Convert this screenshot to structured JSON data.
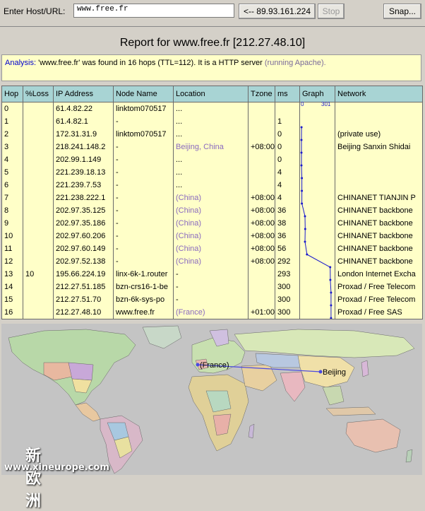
{
  "toolbar": {
    "label": "Enter Host/URL:",
    "host_value": "www.free.fr",
    "ip_button": "<-- 89.93.161.224",
    "stop_button": "Stop",
    "snap_button": "Snap..."
  },
  "report": {
    "title": "Report for www.free.fr [212.27.48.10]"
  },
  "analysis": {
    "label": "Analysis:",
    "text": " 'www.free.fr'  was found in 16 hops (TTL=112). It is a HTTP server ",
    "server_note": "(running Apache)."
  },
  "table": {
    "headers": [
      "Hop",
      "%Loss",
      "IP Address",
      "Node Name",
      "Location",
      "Tzone",
      "ms",
      "Graph",
      "Network"
    ],
    "graph_scale": {
      "min": "0",
      "max": "301"
    },
    "rows": [
      {
        "hop": "0",
        "loss": "",
        "ip": "61.4.82.22",
        "node": "linktom070517",
        "loc": "...",
        "tz": "",
        "ms": "",
        "net": ""
      },
      {
        "hop": "1",
        "loss": "",
        "ip": "61.4.82.1",
        "node": "-",
        "loc": "...",
        "tz": "",
        "ms": "1",
        "net": ""
      },
      {
        "hop": "2",
        "loss": "",
        "ip": "172.31.31.9",
        "node": "linktom070517",
        "loc": "...",
        "tz": "",
        "ms": "0",
        "net": "(private use)"
      },
      {
        "hop": "3",
        "loss": "",
        "ip": "218.241.148.2",
        "node": "-",
        "loc": "Beijing, China",
        "tz": "+08:00",
        "ms": "0",
        "net": "Beijing Sanxin Shidai"
      },
      {
        "hop": "4",
        "loss": "",
        "ip": "202.99.1.149",
        "node": "-",
        "loc": "...",
        "tz": "",
        "ms": "0",
        "net": ""
      },
      {
        "hop": "5",
        "loss": "",
        "ip": "221.239.18.13",
        "node": "-",
        "loc": "...",
        "tz": "",
        "ms": "4",
        "net": ""
      },
      {
        "hop": "6",
        "loss": "",
        "ip": "221.239.7.53",
        "node": "-",
        "loc": "...",
        "tz": "",
        "ms": "4",
        "net": ""
      },
      {
        "hop": "7",
        "loss": "",
        "ip": "221.238.222.1",
        "node": "-",
        "loc": "(China)",
        "tz": "+08:00",
        "ms": "4",
        "net": "CHINANET TIANJIN P"
      },
      {
        "hop": "8",
        "loss": "",
        "ip": "202.97.35.125",
        "node": "-",
        "loc": "(China)",
        "tz": "+08:00",
        "ms": "36",
        "net": "CHINANET backbone"
      },
      {
        "hop": "9",
        "loss": "",
        "ip": "202.97.35.186",
        "node": "-",
        "loc": "(China)",
        "tz": "+08:00",
        "ms": "38",
        "net": "CHINANET backbone"
      },
      {
        "hop": "10",
        "loss": "",
        "ip": "202.97.60.206",
        "node": "-",
        "loc": "(China)",
        "tz": "+08:00",
        "ms": "36",
        "net": "CHINANET backbone"
      },
      {
        "hop": "11",
        "loss": "",
        "ip": "202.97.60.149",
        "node": "-",
        "loc": "(China)",
        "tz": "+08:00",
        "ms": "56",
        "net": "CHINANET backbone"
      },
      {
        "hop": "12",
        "loss": "",
        "ip": "202.97.52.138",
        "node": "-",
        "loc": "(China)",
        "tz": "+08:00",
        "ms": "292",
        "net": "CHINANET backbone"
      },
      {
        "hop": "13",
        "loss": "10",
        "ip": "195.66.224.19",
        "node": "linx-6k-1.router",
        "loc": "-",
        "tz": "",
        "ms": "293",
        "net": "London Internet Excha"
      },
      {
        "hop": "14",
        "loss": "",
        "ip": "212.27.51.185",
        "node": "bzn-crs16-1-be",
        "loc": "-",
        "tz": "",
        "ms": "300",
        "net": "Proxad / Free Telecom"
      },
      {
        "hop": "15",
        "loss": "",
        "ip": "212.27.51.70",
        "node": "bzn-6k-sys-po",
        "loc": "-",
        "tz": "",
        "ms": "300",
        "net": "Proxad / Free Telecom"
      },
      {
        "hop": "16",
        "loss": "",
        "ip": "212.27.48.10",
        "node": "www.free.fr",
        "loc": "(France)",
        "tz": "+01:00",
        "ms": "300",
        "net": "Proxad / Free SAS"
      }
    ]
  },
  "map": {
    "label_france": "(France)",
    "label_beijing": "Beijing",
    "route_color": "#4a4ae0"
  },
  "watermark": {
    "cn": "新欧洲",
    "url": "www.xineurope.com"
  },
  "colors": {
    "header_bg": "#a8d4d4",
    "row_bg": "#ffffc8",
    "location_link": "#8a6abf",
    "analysis_label": "#0000cc",
    "graph_line": "#1a1acc"
  }
}
